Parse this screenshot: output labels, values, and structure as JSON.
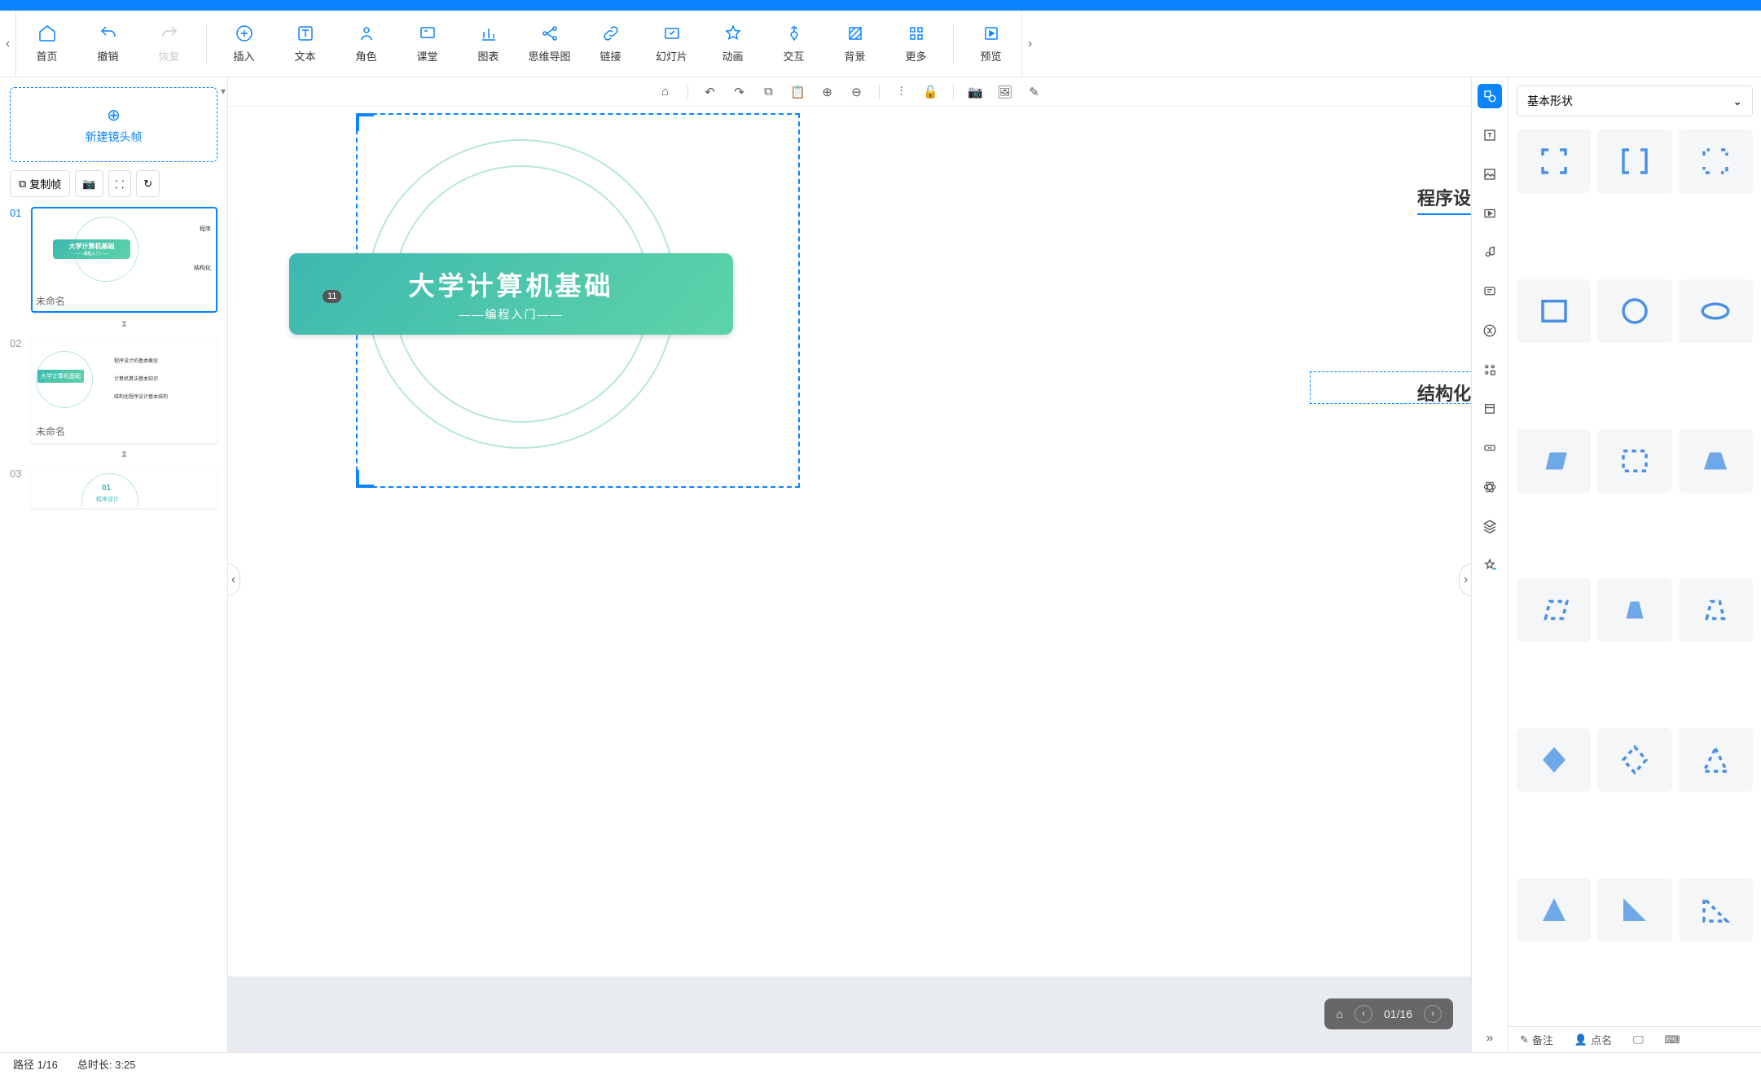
{
  "toolbar": {
    "home": "首页",
    "undo": "撤销",
    "redo": "恢复",
    "insert": "插入",
    "text": "文本",
    "role": "角色",
    "class": "课堂",
    "chart": "图表",
    "mindmap": "思维导图",
    "link": "链接",
    "slide": "幻灯片",
    "anim": "动画",
    "interact": "交互",
    "bg": "背景",
    "more": "更多",
    "preview": "预览"
  },
  "sidebar": {
    "new_frame": "新建镜头帧",
    "copy_frame": "复制帧",
    "thumbs": [
      {
        "num": "01",
        "caption": "未命名",
        "title": "大学计算机基础",
        "sub": "——编程入门——",
        "lbl1": "程序",
        "lbl2": "结构化"
      },
      {
        "num": "02",
        "caption": "未命名",
        "title": "大学计算机基础",
        "line1": "程序设计的基本概念",
        "line2": "计算机算法基本知识",
        "line3": "结构化程序设计基本结构"
      },
      {
        "num": "03",
        "badge": "01",
        "sub": "程序设计"
      }
    ]
  },
  "canvas": {
    "title": "大学计算机基础",
    "subtitle": "——编程入门——",
    "label1": "程序设",
    "label2": "结构化",
    "badge": "11",
    "nav": {
      "current": "01",
      "total": "16"
    }
  },
  "shapes": {
    "header": "基本形状"
  },
  "footer": {
    "notes": "备注",
    "roll": "点名"
  },
  "status": {
    "path": "路径 1/16",
    "duration": "总时长:  3:25"
  }
}
